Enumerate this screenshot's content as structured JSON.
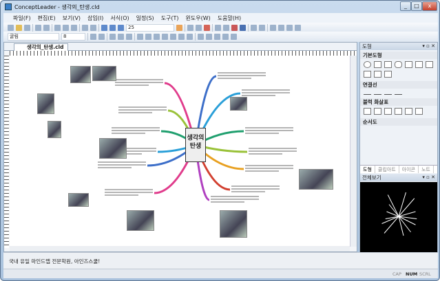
{
  "window": {
    "title": "ConceptLeader - 생각의_탄생.cld",
    "min": "_",
    "max": "□",
    "close": "x"
  },
  "menu": [
    "파일(F)",
    "편집(E)",
    "보기(V)",
    "삽입(I)",
    "서식(O)",
    "일정(S)",
    "도구(T)",
    "윈도우(W)",
    "도움말(H)"
  ],
  "toolbar": {
    "zoom": "25",
    "font": "굴림",
    "font_size": "8"
  },
  "document": {
    "tab": "생각의_탄생.cld",
    "center_topic": "생각의 탄생"
  },
  "branch_colors": [
    "#e03c8c",
    "#3d6fc9",
    "#2a9fd8",
    "#1f9f6e",
    "#9ac23a",
    "#e8a020",
    "#d24030",
    "#b040c0"
  ],
  "panel": {
    "title": "도형",
    "sections": [
      "기본도형",
      "연결선",
      "블럭 화살표",
      "순서도"
    ],
    "tabs": [
      "도형",
      "클립아트",
      "아이콘",
      "노트"
    ],
    "overview_title": "전체보기"
  },
  "message": "국내 유일 마인드맵 전문학원, 아인즈스쿨!",
  "status": {
    "cap": "CAP",
    "num": "NUM",
    "scrl": "SCRL"
  }
}
